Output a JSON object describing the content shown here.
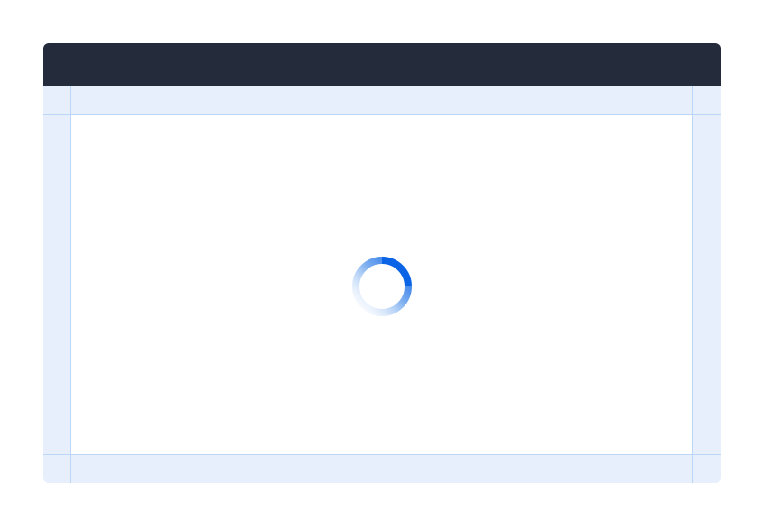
{
  "window": {
    "title": ""
  },
  "loading": {
    "state": "loading",
    "icon": "spinner-icon",
    "accent_color": "#0b63e5",
    "track_color": "#e6effb"
  },
  "colors": {
    "titlebar": "#242b3b",
    "frame": "#e6effb",
    "guide": "#bcd6f7",
    "canvas": "#ffffff"
  }
}
